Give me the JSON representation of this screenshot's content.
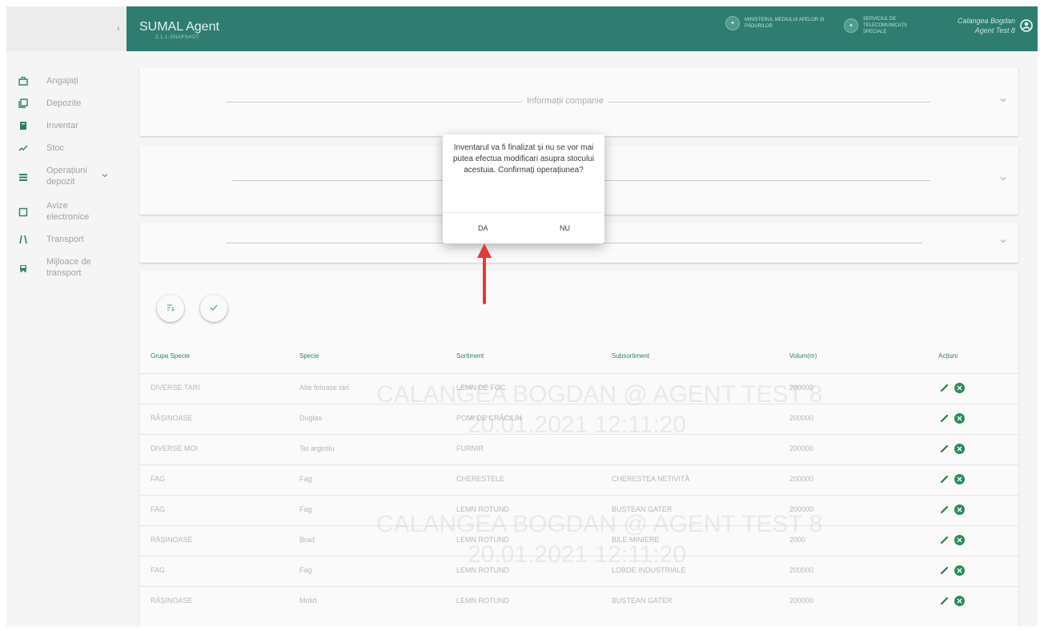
{
  "app": {
    "title": "SUMAL Agent",
    "subtitle": "2.1.1-SNAPSHOT"
  },
  "header": {
    "org1": "MINISTERUL MEDIULUI APELOR ȘI PĂDURILOR",
    "org2": "SERVICIUL DE TELECOMUNICAȚII SPECIALE",
    "user_name": "Calangea Bogdan",
    "user_role": "Agent Test 8"
  },
  "sidebar": {
    "collapse": "‹",
    "items": [
      {
        "label": "Angajați",
        "icon": "briefcase-icon"
      },
      {
        "label": "Depozite",
        "icon": "library-icon"
      },
      {
        "label": "Inventar",
        "icon": "book-icon"
      },
      {
        "label": "Stoc",
        "icon": "trend-icon"
      },
      {
        "label": "Operațiuni depozit",
        "icon": "list-icon"
      },
      {
        "label": "Avize electronice",
        "icon": "note-icon"
      },
      {
        "label": "Transport",
        "icon": "road-icon"
      },
      {
        "label": "Mijloace de transport",
        "icon": "car-icon"
      }
    ]
  },
  "panels": {
    "company_info": "Informații companie"
  },
  "table": {
    "headers": [
      "Grupa Specie",
      "Specie",
      "Sortiment",
      "Subsortiment",
      "Volum(m)",
      "Acțiuni"
    ],
    "rows": [
      [
        "DIVERSE TARI",
        "Alte foioase tari",
        "LEMN DE FOC",
        "-",
        "200000"
      ],
      [
        "RĂȘINOASE",
        "Duglas",
        "POMI DE CRĂCIUN",
        "",
        "200000"
      ],
      [
        "DIVERSE MOI",
        "Tei argintiu",
        "FURNIR",
        "",
        "200000"
      ],
      [
        "FAG",
        "Fag",
        "CHERESTELE",
        "CHERESTEA NETIVITĂ",
        "200000"
      ],
      [
        "FAG",
        "Fag",
        "LEMN ROTUND",
        "BUȘTEAN GATER",
        "200000"
      ],
      [
        "RĂȘINOASE",
        "Brad",
        "LEMN ROTUND",
        "BILE MINIERE",
        "2000"
      ],
      [
        "FAG",
        "Fag",
        "LEMN ROTUND",
        "LOBDE INDUSTRIALE",
        "200000"
      ],
      [
        "RĂȘINOASE",
        "Molid",
        "LEMN ROTUND",
        "BUȘTEAN GATER",
        "200000"
      ]
    ]
  },
  "watermark": {
    "line1": "CALANGEA BOGDAN @ AGENT TEST 8",
    "line2": "20.01.2021 12:11:20"
  },
  "dialog": {
    "message": "Inventarul va fi finalizat și nu se vor mai putea efectua modificari asupra stocului acestuia. Confirmați operațiunea?",
    "yes": "DA",
    "no": "NU"
  },
  "colors": {
    "primary": "#2e7d70",
    "annotation_arrow": "#e53935"
  }
}
